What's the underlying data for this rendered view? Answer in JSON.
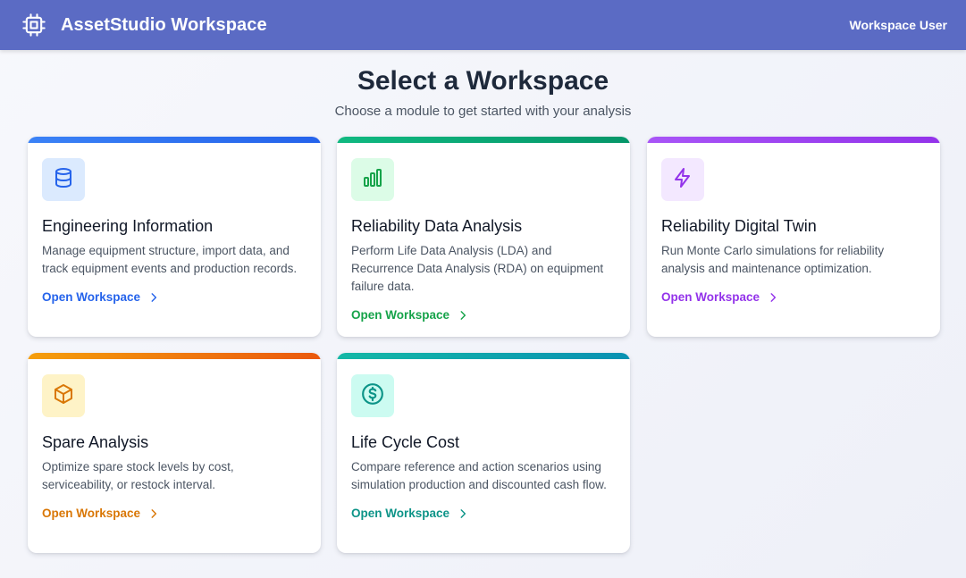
{
  "header": {
    "app_title": "AssetStudio Workspace",
    "logo_icon": "cpu-chip-icon",
    "user_label": "Workspace User",
    "background_color": "#5b6bc4"
  },
  "main": {
    "title": "Select a Workspace",
    "subtitle": "Choose a module to get started with your analysis"
  },
  "cards": [
    {
      "title": "Engineering Information",
      "description": "Manage equipment structure, import data, and track equipment events and production records.",
      "link_label": "Open Workspace",
      "icon": "database-icon",
      "accent": "#2563eb",
      "accent_end": "#1d4ed8",
      "icon_bg": "#dbeafe"
    },
    {
      "title": "Reliability Data Analysis",
      "description": "Perform Life Data Analysis (LDA) and Recurrence Data Analysis (RDA) on equipment failure data.",
      "link_label": "Open Workspace",
      "icon": "bar-chart-icon",
      "accent": "#16a34a",
      "accent_end": "#059669",
      "icon_bg": "#dcfce7"
    },
    {
      "title": "Reliability Digital Twin",
      "description": "Run Monte Carlo simulations for reliability analysis and maintenance optimization.",
      "link_label": "Open Workspace",
      "icon": "lightning-bolt-icon",
      "accent": "#9333ea",
      "accent_end": "#a855f7",
      "icon_bg": "#f3e8ff"
    },
    {
      "title": "Spare Analysis",
      "description": "Optimize spare stock levels by cost, serviceability, or restock interval.",
      "link_label": "Open Workspace",
      "icon": "package-box-icon",
      "accent": "#d97706",
      "accent_end": "#ea580c",
      "icon_bg": "#fef3c7"
    },
    {
      "title": "Life Cycle Cost",
      "description": "Compare reference and action scenarios using simulation production and discounted cash flow.",
      "link_label": "Open Workspace",
      "icon": "dollar-circle-icon",
      "accent": "#0d9488",
      "accent_end": "#0891b2",
      "icon_bg": "#ccfbf1"
    }
  ]
}
